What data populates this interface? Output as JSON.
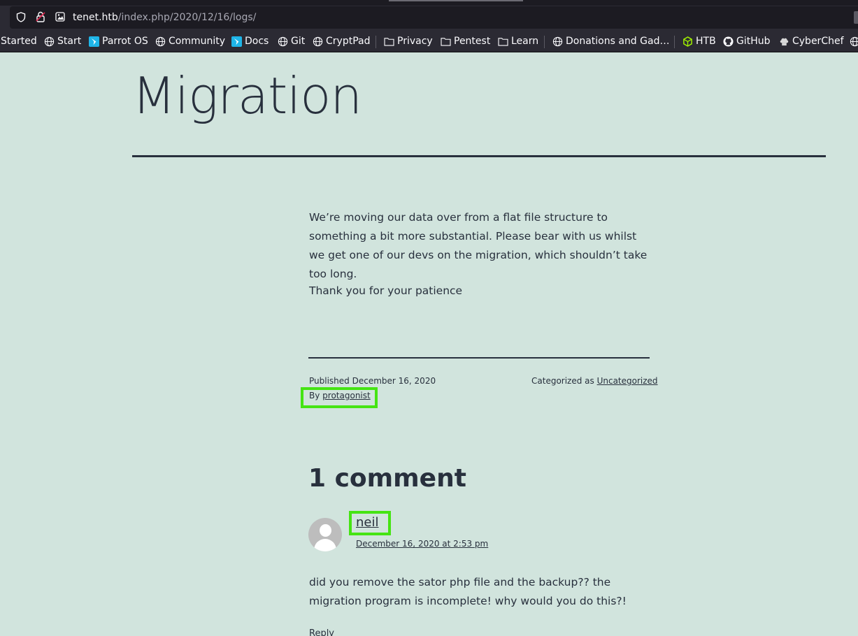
{
  "browser": {
    "url_host": "tenet.htb",
    "url_path": "/index.php/2020/12/16/logs/",
    "bookmarks": [
      {
        "label": "Started",
        "icon": "none"
      },
      {
        "label": "Start",
        "icon": "globe-icon"
      },
      {
        "label": "Parrot OS",
        "icon": "parrot-icon"
      },
      {
        "label": "Community",
        "icon": "globe-icon"
      },
      {
        "label": "Docs",
        "icon": "parrot-icon"
      },
      {
        "label": "Git",
        "icon": "globe-icon"
      },
      {
        "label": "CryptPad",
        "icon": "globe-icon"
      },
      {
        "label": "Privacy",
        "icon": "folder-icon"
      },
      {
        "label": "Pentest",
        "icon": "folder-icon"
      },
      {
        "label": "Learn",
        "icon": "folder-icon"
      },
      {
        "label": "Donations and Gad…",
        "icon": "globe-icon"
      },
      {
        "label": "HTB",
        "icon": "htb-cube-icon"
      },
      {
        "label": "GitHub",
        "icon": "github-icon"
      },
      {
        "label": "CyberChef",
        "icon": "chef-hat-icon"
      }
    ]
  },
  "post": {
    "title": "Migration",
    "paragraphs": [
      "We’re moving our data over from a flat file structure to something a bit more substantial. Please bear with us whilst we get one of our devs on the migration, which shouldn’t take too long.",
      "Thank you for your patience"
    ],
    "published_label": "Published",
    "published_date": "December 16, 2020",
    "by_label": "By",
    "author": "protagonist",
    "categorized_label": "Categorized as",
    "category": "Uncategorized"
  },
  "comments": {
    "title": "1 comment",
    "items": [
      {
        "author": "neil",
        "date": "December 16, 2020 at 2:53 pm",
        "body": "did you remove the sator php file and the backup?? the migration program is incomplete! why would you do this?!",
        "reply_label": "Reply"
      }
    ]
  },
  "colors": {
    "page_background": "#d1e4dd",
    "text": "#28303d",
    "highlight": "#45e413",
    "browser_chrome": "#2b2a33"
  }
}
